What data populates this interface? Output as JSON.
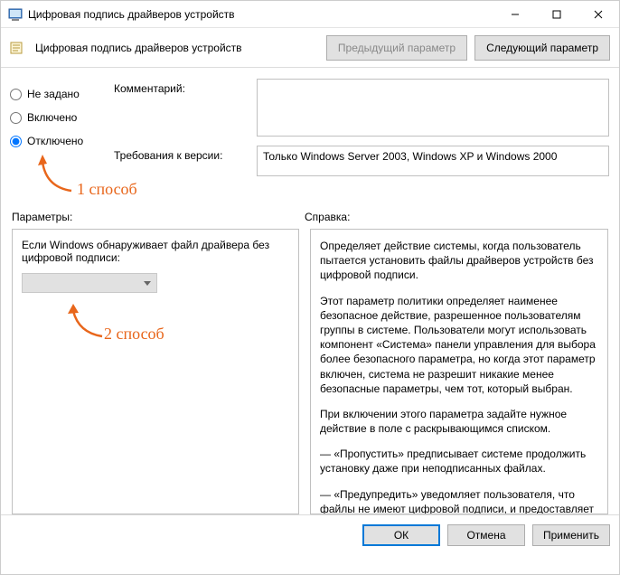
{
  "window": {
    "title": "Цифровая подпись драйверов устройств"
  },
  "toolbar": {
    "title": "Цифровая подпись драйверов устройств",
    "prev_label": "Предыдущий параметр",
    "next_label": "Следующий параметр"
  },
  "state": {
    "not_configured": "Не задано",
    "enabled": "Включено",
    "disabled": "Отключено"
  },
  "fields": {
    "comment_label": "Комментарий:",
    "requirements_label": "Требования к версии:",
    "requirements_value": "Только Windows Server 2003, Windows XP и Windows 2000"
  },
  "sections": {
    "params_label": "Параметры:",
    "help_label": "Справка:"
  },
  "params_panel": {
    "text": "Если Windows обнаруживает файл драйвера без цифровой подписи:"
  },
  "help_panel": {
    "p1": "Определяет действие системы, когда пользователь пытается установить файлы драйверов устройств без цифровой подписи.",
    "p2": "Этот параметр политики определяет наименее безопасное действие, разрешенное пользователям группы в системе. Пользователи могут использовать компонент «Система» панели управления для выбора более безопасного параметра, но когда этот параметр включен, система не разрешит никакие менее безопасные параметры, чем тот, который выбран.",
    "p3": "При включении этого параметра задайте нужное действие в поле с раскрывающимся списком.",
    "p4": "— «Пропустить» предписывает системе продолжить установку даже при неподписанных файлах.",
    "p5": "— «Предупредить» уведомляет пользователя, что файлы не имеют цифровой подписи, и предоставляет пользователю"
  },
  "annotations": {
    "one": "1 способ",
    "two": "2 способ"
  },
  "footer": {
    "ok": "ОК",
    "cancel": "Отмена",
    "apply": "Применить"
  }
}
